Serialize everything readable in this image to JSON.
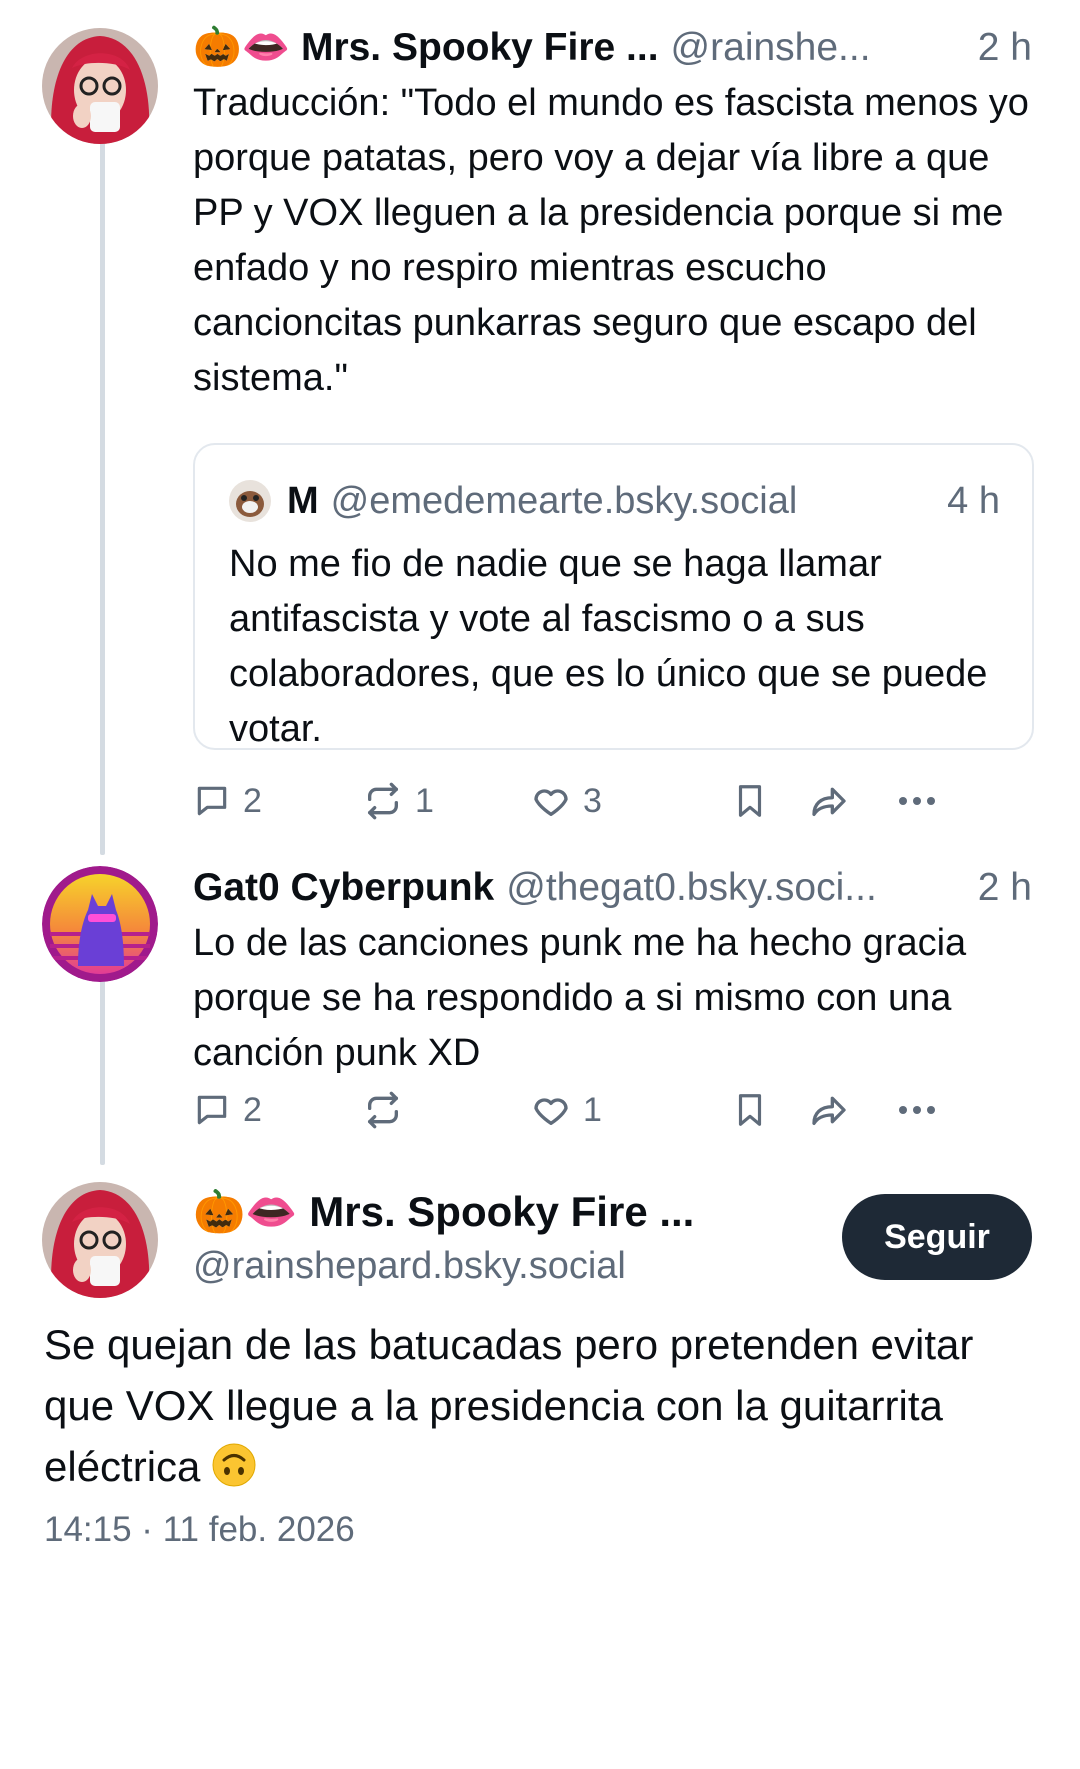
{
  "posts": [
    {
      "display_name": "🎃👄 Mrs. Spooky Fire ...",
      "handle": "@rainshe...",
      "time": "2 h",
      "text": "Traducción: \"Todo el mundo es fascista menos yo porque patatas, pero voy a dejar vía libre a que PP y VOX lleguen a la presidencia porque si me enfado y no respiro mientras escucho cancioncitas punkarras seguro que escapo del sistema.\"",
      "quote": {
        "display_name": "M",
        "handle": "@emedemearte.bsky.social",
        "time": "4 h",
        "text": "No me fio de nadie que se haga llamar antifascista y vote al fascismo o a sus colaboradores, que es lo único que se puede votar."
      },
      "actions": {
        "replies": "2",
        "reposts": "1",
        "likes": "3"
      }
    },
    {
      "display_name": "Gat0 Cyberpunk",
      "handle": "@thegat0.bsky.soci...",
      "time": "2 h",
      "text": "Lo de las canciones punk me ha hecho gracia porque se ha respondido a si mismo con una canción punk XD",
      "actions": {
        "replies": "2",
        "reposts": "",
        "likes": "1"
      }
    }
  ],
  "main_post": {
    "display_name": "🎃👄 Mrs. Spooky Fire ...",
    "handle": "@rainshepard.bsky.social",
    "follow_label": "Seguir",
    "text": "Se quejan de las batucadas pero pretenden evitar que VOX llegue a la presidencia con la guitarrita eléctrica",
    "emoji_icon": "upside-down-face-icon",
    "timestamp": "14:15 · 11 feb. 2026"
  },
  "colors": {
    "text": "#0b0f14",
    "muted": "#5f6b7a",
    "thread_line": "#d4dbe2",
    "button_bg": "#1e2936"
  }
}
